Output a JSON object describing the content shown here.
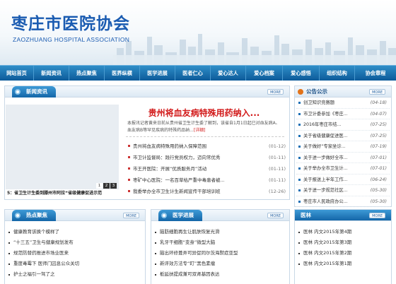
{
  "header": {
    "title_cn": "枣庄市医院协会",
    "title_en": "ZAOZHUANG HOSPITAL ASSOCIATION"
  },
  "nav": {
    "items": [
      "网站首页",
      "新闻资讯",
      "热点聚焦",
      "医界纵横",
      "医学进展",
      "医者仁心",
      "爱心达人",
      "爱心档案",
      "爱心感悟",
      "组织结构",
      "协会章程"
    ]
  },
  "news": {
    "title": "新闻资讯",
    "more": "MORE",
    "headline": "贵州将血友病特殊用药纳入...",
    "summary": "本报讯记者黄来日前从贵州省卫生计生委了解到，该省自1月1日起已对血友病A、血友病B等罕见疾病的特殊药品纳...",
    "summary_more": "[详细]",
    "slide_caption": "5：省卫生计生委到滕州市阿拉“省级健康促进示范",
    "slide_numbers": [
      "1",
      "2",
      "3"
    ],
    "items": [
      {
        "text": "贵州将血友病特殊用药纳入保障范围",
        "date": "(01-12)"
      },
      {
        "text": "市卫计监督局：践行党员权力，迈向常优秀",
        "date": "(01-11)"
      },
      {
        "text": "市王开医院：开展“优质服务月”活动",
        "date": "(01-11)"
      },
      {
        "text": "枣矿中心医院：一名百草枯严重中毒患者被...",
        "date": "(01-11)"
      },
      {
        "text": "我委举办全市卫生计生新闻宣传干部培训班",
        "date": "(12-26)"
      }
    ]
  },
  "notice": {
    "title": "公告公示",
    "more": "MORE",
    "items": [
      {
        "text": "创卫知识竞赛题",
        "date": "(04-18)"
      },
      {
        "text": "市卫计委参加《枣庄...",
        "date": "(04-07)"
      },
      {
        "text": "2016年枣庄市结...",
        "date": "(07-25)"
      },
      {
        "text": "关于省级健康促进医...",
        "date": "(07-25)"
      },
      {
        "text": "关于做好“专家坐诊...",
        "date": "(07-19)"
      },
      {
        "text": "关于进一步做好全市...",
        "date": "(07-01)"
      },
      {
        "text": "关于举办全市卫生计...",
        "date": "(07-01)"
      },
      {
        "text": "关于报送上半年工作...",
        "date": "(06-24)"
      },
      {
        "text": "关于进一步规范社区...",
        "date": "(05-30)"
      },
      {
        "text": "枣庄市人民政府办公...",
        "date": "(05-30)"
      }
    ]
  },
  "hot": {
    "title": "热点聚焦",
    "more": "MORE",
    "items": [
      "健康教育该换个模样了",
      "“十三五”卫生与健康规划发布",
      "规范防替药推进市场业医来",
      "重度毒霉下 医师门囚息公众关切",
      "护士之福引一驾了之"
    ]
  },
  "progress": {
    "title": "医学进展",
    "more": "MORE",
    "items": [
      "脑肪细胞再生让肌肤恢复光滑",
      "乳牙干细胞“变身”微型大脑",
      "脑出环修葺弄可异促同尔茨海默症亚型",
      "新评效方法专“盯”黑色素瘤",
      "栀延扶提成兼可双肾基因表达"
    ]
  },
  "medforest": {
    "title": "医林",
    "more": "MORE",
    "items": [
      "医林 内文2015年第4期",
      "医林 内文2015年第3期",
      "医林 内文2015年第2期",
      "医林 内文2015年第1期"
    ]
  }
}
